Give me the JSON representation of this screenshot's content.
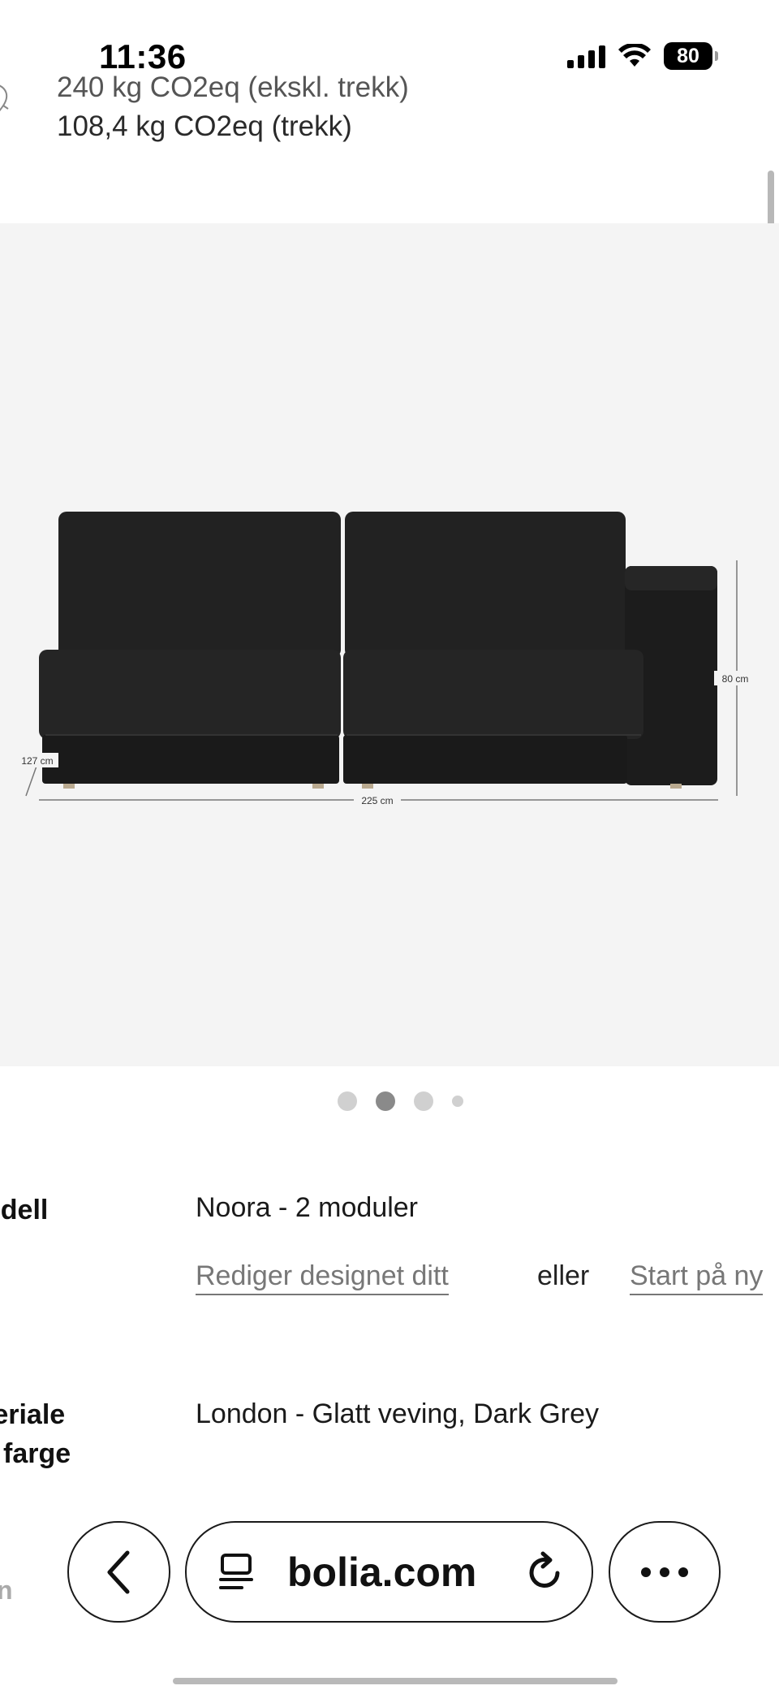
{
  "status_bar": {
    "time": "11:36",
    "battery": "80"
  },
  "sustainability": {
    "line1": "240 kg CO2eq (ekskl. trekk)",
    "line2": "108,4 kg CO2eq (trekk)"
  },
  "product_image": {
    "depth_label": "127 cm",
    "width_label": "225 cm",
    "height_label": "80 cm"
  },
  "carousel": {
    "dot_count": 4,
    "active_index": 1
  },
  "specs": {
    "model_label": "odell",
    "model_value": "Noora - 2 moduler",
    "edit_link": "Rediger designet ditt",
    "or_text": "eller",
    "restart_link": "Start på ny",
    "material_label_line1": "teriale",
    "material_label_line2": "farge",
    "material_value": "London - Glatt veving, Dark Grey",
    "next_label_fragment": "n"
  },
  "browser": {
    "url": "bolia.com"
  },
  "colors": {
    "background": "#ffffff",
    "image_bg": "#f4f4f4",
    "sofa": "#1e1e1e",
    "link": "#777777"
  }
}
